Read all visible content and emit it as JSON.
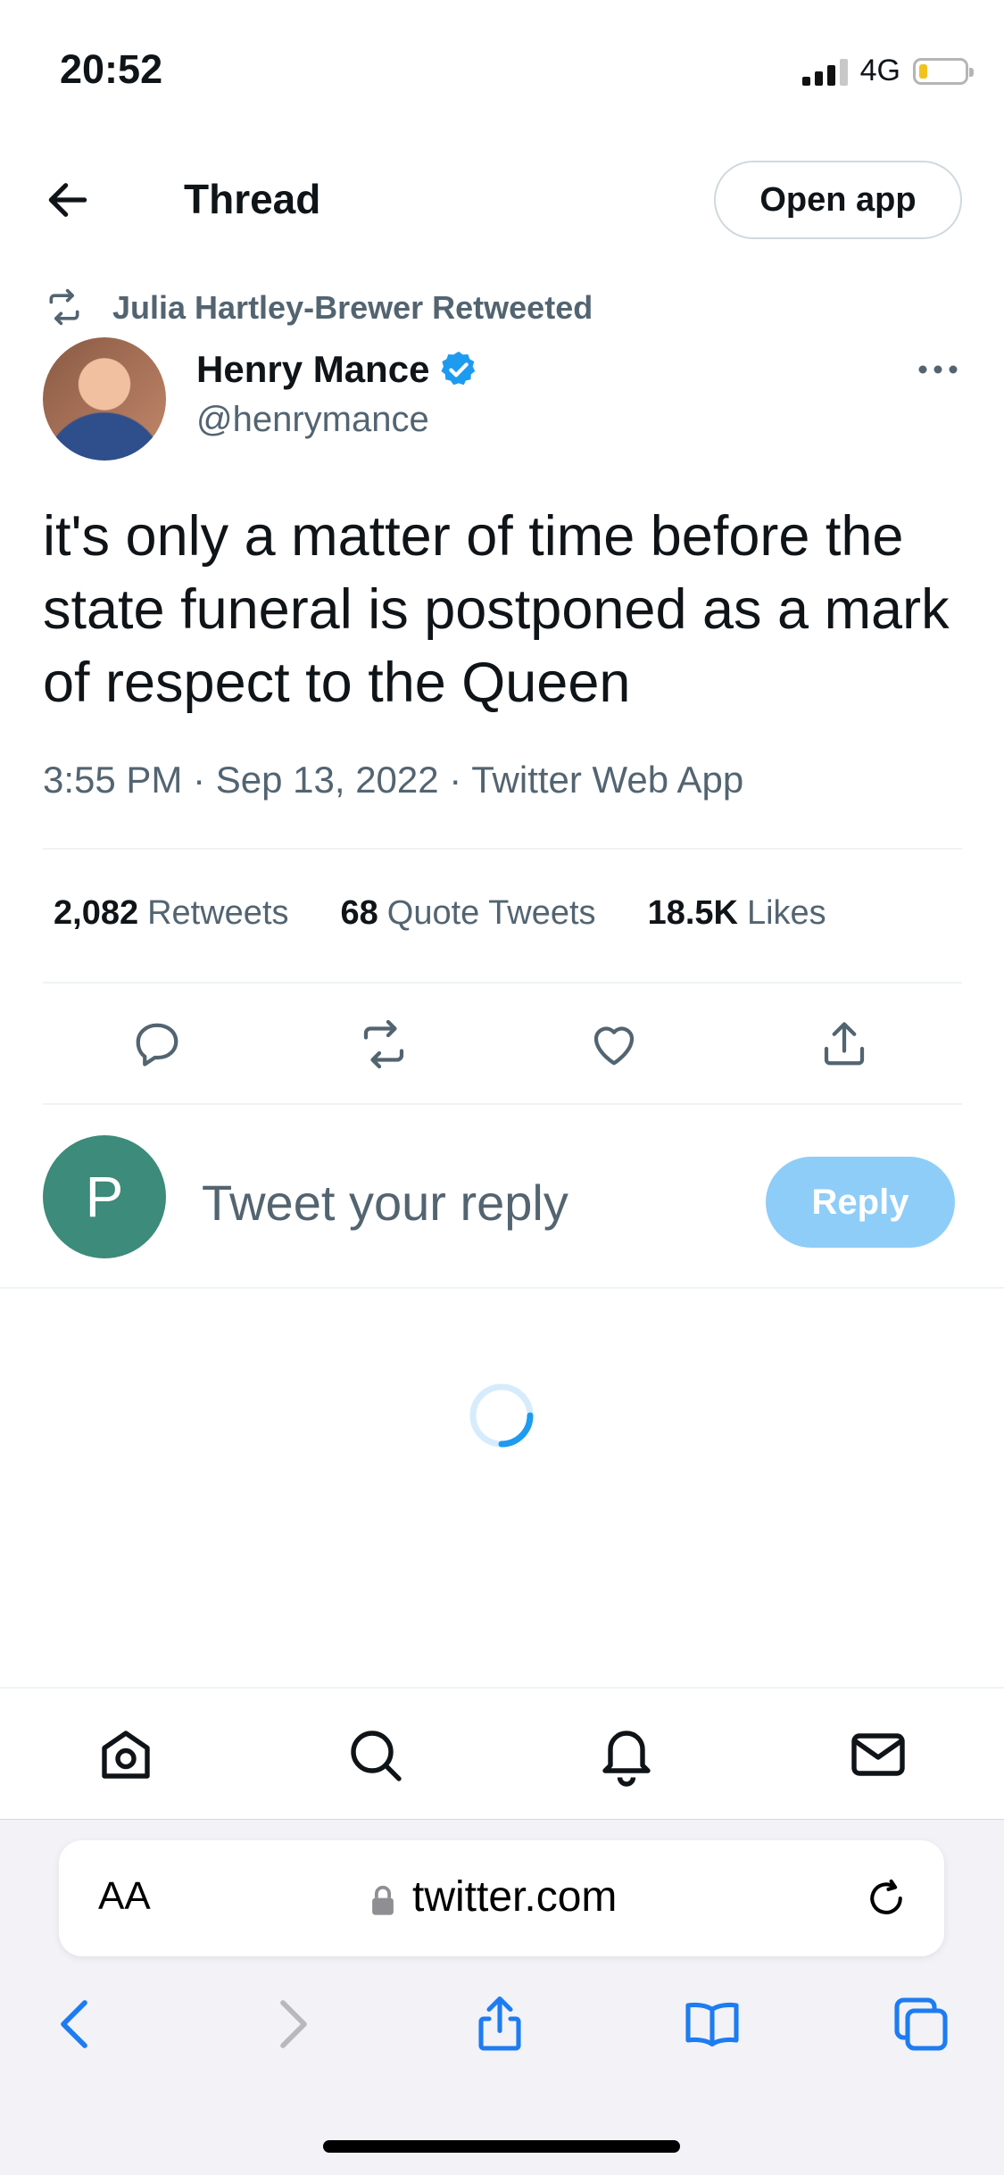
{
  "status_bar": {
    "time": "20:52",
    "network": "4G"
  },
  "header": {
    "title": "Thread",
    "open_app_label": "Open app"
  },
  "retweet_banner": {
    "text": "Julia Hartley-Brewer Retweeted"
  },
  "tweet": {
    "author_name": "Henry Mance",
    "author_handle": "@henrymance",
    "text": "it's only a matter of time before the state funeral is postponed as a mark of respect to the Queen",
    "meta": "3:55 PM · Sep 13, 2022 · Twitter Web App"
  },
  "stats": {
    "retweets_count": "2,082",
    "retweets_label": "Retweets",
    "quotes_count": "68",
    "quotes_label": "Quote Tweets",
    "likes_count": "18.5K",
    "likes_label": "Likes"
  },
  "reply_box": {
    "avatar_letter": "P",
    "placeholder": "Tweet your reply",
    "button_label": "Reply"
  },
  "browser": {
    "aa_label": "AA",
    "url": "twitter.com"
  },
  "icons": {
    "back": "arrow-left-icon",
    "retweet": "retweet-icon",
    "verified": "verified-badge-icon",
    "more": "more-icon",
    "reply": "reply-icon",
    "like": "heart-icon",
    "share": "share-icon",
    "spinner": "loading-spinner-icon",
    "tabs": [
      "home-icon",
      "search-icon",
      "bell-icon",
      "mail-icon"
    ]
  },
  "colors": {
    "accent": "#1d9bf0",
    "reply_button": "#8ecdf8",
    "muted_text": "#536471",
    "reply_avatar": "#3d8b7a"
  }
}
